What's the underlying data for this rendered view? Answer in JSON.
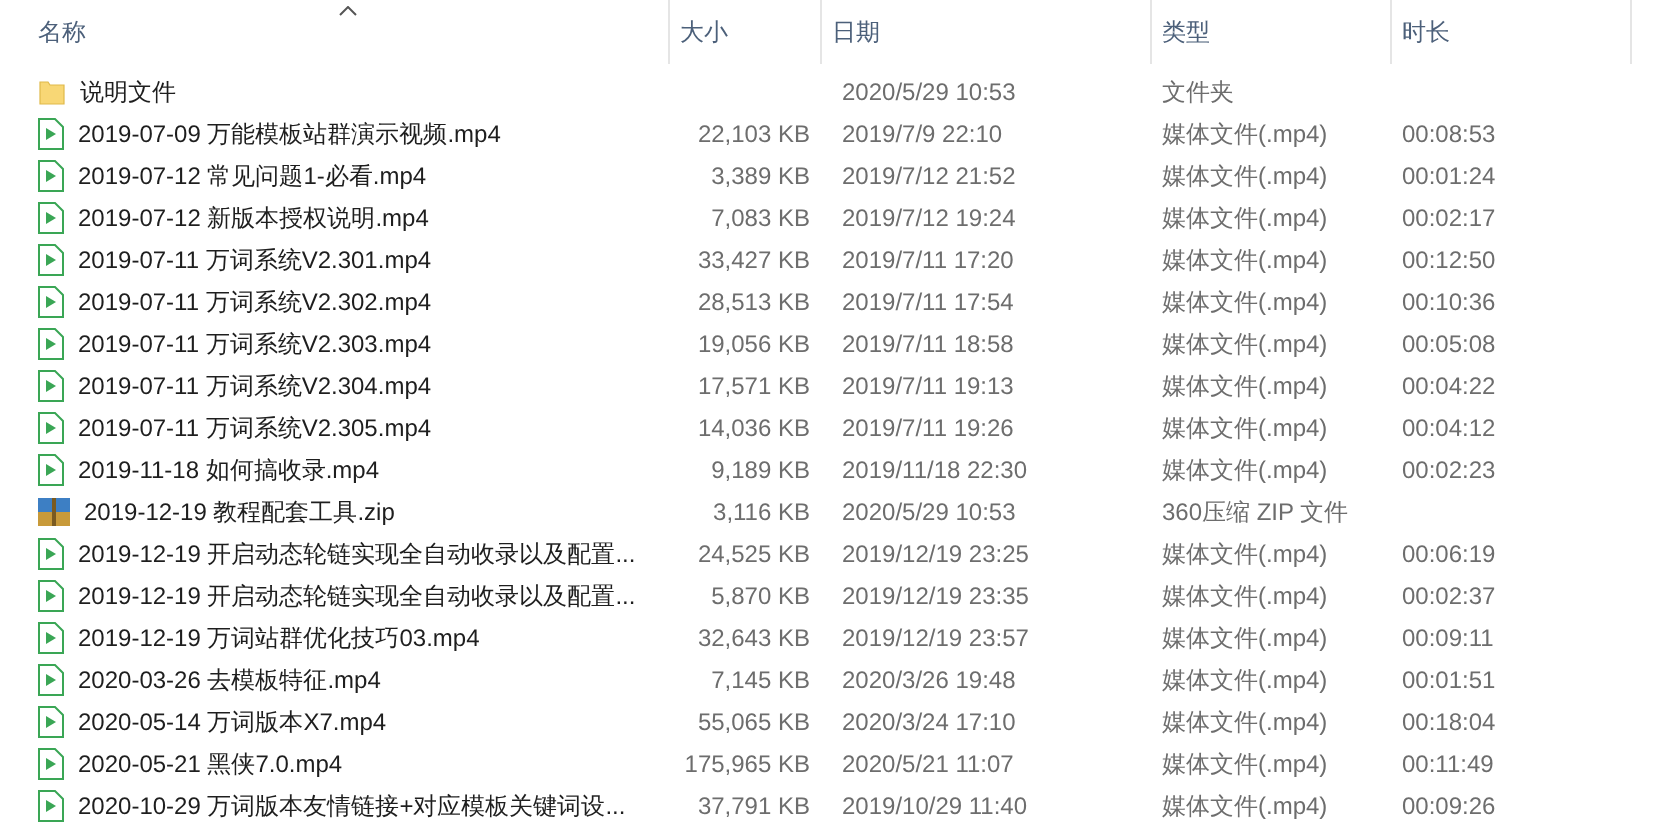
{
  "columns": [
    {
      "label": "名称",
      "sorted": true
    },
    {
      "label": "大小",
      "sorted": false
    },
    {
      "label": "日期",
      "sorted": false
    },
    {
      "label": "类型",
      "sorted": false
    },
    {
      "label": "时长",
      "sorted": false
    }
  ],
  "rows": [
    {
      "kind": "folder",
      "name": "说明文件",
      "size": "",
      "date": "2020/5/29 10:53",
      "type": "文件夹",
      "duration": ""
    },
    {
      "kind": "video",
      "name": "2019-07-09 万能模板站群演示视频.mp4",
      "size": "22,103 KB",
      "date": "2019/7/9 22:10",
      "type": "媒体文件(.mp4)",
      "duration": "00:08:53"
    },
    {
      "kind": "video",
      "name": "2019-07-12 常见问题1-必看.mp4",
      "size": "3,389 KB",
      "date": "2019/7/12 21:52",
      "type": "媒体文件(.mp4)",
      "duration": "00:01:24"
    },
    {
      "kind": "video",
      "name": "2019-07-12 新版本授权说明.mp4",
      "size": "7,083 KB",
      "date": "2019/7/12 19:24",
      "type": "媒体文件(.mp4)",
      "duration": "00:02:17"
    },
    {
      "kind": "video",
      "name": "2019-07-11 万词系统V2.301.mp4",
      "size": "33,427 KB",
      "date": "2019/7/11 17:20",
      "type": "媒体文件(.mp4)",
      "duration": "00:12:50"
    },
    {
      "kind": "video",
      "name": "2019-07-11 万词系统V2.302.mp4",
      "size": "28,513 KB",
      "date": "2019/7/11 17:54",
      "type": "媒体文件(.mp4)",
      "duration": "00:10:36"
    },
    {
      "kind": "video",
      "name": "2019-07-11 万词系统V2.303.mp4",
      "size": "19,056 KB",
      "date": "2019/7/11 18:58",
      "type": "媒体文件(.mp4)",
      "duration": "00:05:08"
    },
    {
      "kind": "video",
      "name": "2019-07-11 万词系统V2.304.mp4",
      "size": "17,571 KB",
      "date": "2019/7/11 19:13",
      "type": "媒体文件(.mp4)",
      "duration": "00:04:22"
    },
    {
      "kind": "video",
      "name": "2019-07-11 万词系统V2.305.mp4",
      "size": "14,036 KB",
      "date": "2019/7/11 19:26",
      "type": "媒体文件(.mp4)",
      "duration": "00:04:12"
    },
    {
      "kind": "video",
      "name": "2019-11-18 如何搞收录.mp4",
      "size": "9,189 KB",
      "date": "2019/11/18 22:30",
      "type": "媒体文件(.mp4)",
      "duration": "00:02:23"
    },
    {
      "kind": "zip",
      "name": "2019-12-19 教程配套工具.zip",
      "size": "3,116 KB",
      "date": "2020/5/29 10:53",
      "type": "360压缩 ZIP 文件",
      "duration": ""
    },
    {
      "kind": "video",
      "name": "2019-12-19 开启动态轮链实现全自动收录以及配置...",
      "size": "24,525 KB",
      "date": "2019/12/19 23:25",
      "type": "媒体文件(.mp4)",
      "duration": "00:06:19"
    },
    {
      "kind": "video",
      "name": "2019-12-19 开启动态轮链实现全自动收录以及配置...",
      "size": "5,870 KB",
      "date": "2019/12/19 23:35",
      "type": "媒体文件(.mp4)",
      "duration": "00:02:37"
    },
    {
      "kind": "video",
      "name": "2019-12-19 万词站群优化技巧03.mp4",
      "size": "32,643 KB",
      "date": "2019/12/19 23:57",
      "type": "媒体文件(.mp4)",
      "duration": "00:09:11"
    },
    {
      "kind": "video",
      "name": "2020-03-26 去模板特征.mp4",
      "size": "7,145 KB",
      "date": "2020/3/26 19:48",
      "type": "媒体文件(.mp4)",
      "duration": "00:01:51"
    },
    {
      "kind": "video",
      "name": "2020-05-14 万词版本X7.mp4",
      "size": "55,065 KB",
      "date": "2020/3/24 17:10",
      "type": "媒体文件(.mp4)",
      "duration": "00:18:04"
    },
    {
      "kind": "video",
      "name": "2020-05-21 黑侠7.0.mp4",
      "size": "175,965 KB",
      "date": "2020/5/21 11:07",
      "type": "媒体文件(.mp4)",
      "duration": "00:11:49"
    },
    {
      "kind": "video",
      "name": "2020-10-29 万词版本友情链接+对应模板关键词设...",
      "size": "37,791 KB",
      "date": "2019/10/29 11:40",
      "type": "媒体文件(.mp4)",
      "duration": "00:09:26"
    }
  ]
}
